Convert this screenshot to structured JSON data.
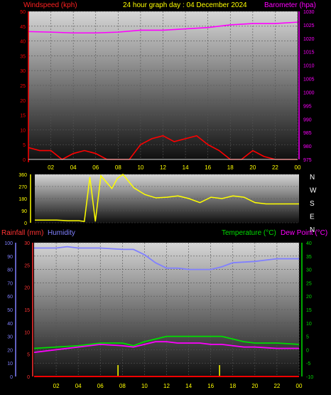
{
  "header": {
    "windspeed_label": "Windspeed (kph)",
    "graph_title": "24 hour graph day : 04 December 2024",
    "barometer_label": "Barometer (hpa)"
  },
  "colors": {
    "background": "#000000",
    "wind": "#ff0000",
    "gust_fill": "#ffffff",
    "avg_wind": "#00cc00",
    "barometer": "#ff00ff",
    "direction": "#ffff00",
    "rain_axis": "#ff3333",
    "humidity": "#8080ff",
    "temperature": "#00dd00",
    "dewpoint": "#ff00ff",
    "rain_mark": "#ffff00",
    "ticks": "#ffff00"
  },
  "chart_data": [
    {
      "type": "line",
      "title": "24 hour graph day : 04 December 2024",
      "x_ticks": [
        "02",
        "04",
        "06",
        "08",
        "10",
        "12",
        "14",
        "16",
        "18",
        "20",
        "22",
        "00"
      ],
      "x_range_hours": [
        0,
        24
      ],
      "left_axis": {
        "label": "Windspeed (kph)",
        "ticks": [
          0,
          5,
          10,
          15,
          20,
          25,
          30,
          35,
          40,
          45,
          50
        ],
        "range": [
          0,
          50
        ]
      },
      "right_axis": {
        "label": "Barometer (hpa)",
        "ticks": [
          975,
          980,
          985,
          990,
          995,
          1000,
          1005,
          1010,
          1015,
          1020,
          1025,
          1030
        ],
        "range": [
          975,
          1030
        ]
      },
      "grid": true,
      "series": [
        {
          "name": "Barometer (hpa)",
          "axis": "right",
          "x": [
            0,
            2,
            4,
            6,
            8,
            10,
            12,
            14,
            16,
            18,
            20,
            22,
            24
          ],
          "y": [
            1022.5,
            1022.3,
            1022,
            1022,
            1022.3,
            1023,
            1023,
            1023.5,
            1024,
            1025,
            1025.5,
            1025.5,
            1026
          ]
        },
        {
          "name": "Windspeed (kph)",
          "axis": "left",
          "x": [
            0,
            1,
            2,
            3,
            4,
            5,
            6,
            7,
            8,
            9,
            10,
            11,
            12,
            13,
            14,
            15,
            16,
            17,
            18,
            19,
            20,
            21,
            22,
            23,
            24
          ],
          "y": [
            4,
            3,
            3,
            0,
            2,
            3,
            2,
            0,
            0,
            0,
            5,
            7,
            8,
            6,
            7,
            8,
            5,
            3,
            0,
            0,
            3,
            1,
            0,
            0,
            0
          ]
        }
      ]
    },
    {
      "type": "line",
      "x_range_hours": [
        0,
        24
      ],
      "left_axis": {
        "ticks": [
          0,
          90,
          180,
          270,
          360
        ],
        "range": [
          0,
          360
        ]
      },
      "right_axis": {
        "ticks": [
          "N",
          "W",
          "S",
          "E",
          "N"
        ]
      },
      "grid": true,
      "series": [
        {
          "name": "wind direction",
          "x": [
            0,
            1,
            2,
            3,
            4,
            4.5,
            5,
            5.5,
            6,
            7,
            7.5,
            8,
            9,
            10,
            11,
            12,
            13,
            14,
            15,
            16,
            17,
            18,
            19,
            20,
            21,
            22,
            23,
            24
          ],
          "y": [
            20,
            20,
            20,
            15,
            15,
            10,
            340,
            10,
            350,
            255,
            330,
            360,
            260,
            210,
            185,
            190,
            200,
            180,
            150,
            190,
            180,
            200,
            190,
            150,
            140,
            140,
            140,
            140
          ]
        }
      ]
    },
    {
      "type": "line",
      "x_ticks": [
        "02",
        "04",
        "06",
        "08",
        "10",
        "12",
        "14",
        "16",
        "18",
        "20",
        "22",
        "00"
      ],
      "x_range_hours": [
        0,
        24
      ],
      "rain_axis": {
        "label": "Rainfall (mm)",
        "ticks": [
          0,
          5,
          10,
          15,
          20,
          25,
          30
        ],
        "range": [
          0,
          30
        ]
      },
      "humidity_axis": {
        "label": "Humidity",
        "ticks": [
          0,
          10,
          20,
          30,
          40,
          50,
          60,
          70,
          80,
          90,
          100
        ],
        "range": [
          0,
          100
        ]
      },
      "temp_axis": {
        "label": "Temperature (°C)",
        "ticks": [
          -10,
          -5,
          0,
          5,
          10,
          15,
          20,
          25,
          30,
          35,
          40
        ],
        "range": [
          -10,
          40
        ]
      },
      "dewpoint_label": "Dew Point (°C)",
      "grid": true,
      "series": [
        {
          "name": "Humidity",
          "axis": "humidity",
          "x": [
            0,
            2,
            3,
            4,
            6,
            8,
            9,
            10,
            11,
            12,
            13,
            14,
            15,
            16,
            17,
            18,
            20,
            22,
            24
          ],
          "y": [
            96,
            96,
            97,
            96,
            96,
            95,
            95,
            91,
            85,
            81,
            81,
            80,
            80,
            80,
            82,
            85,
            86,
            88,
            88
          ]
        },
        {
          "name": "Temperature (°C)",
          "axis": "temp",
          "x": [
            0,
            2,
            4,
            6,
            8,
            9,
            10,
            11,
            12,
            13,
            14,
            15,
            16,
            17,
            18,
            19,
            20,
            22,
            24
          ],
          "y": [
            0.5,
            1,
            1.5,
            2.5,
            2.5,
            1.5,
            3,
            4,
            5,
            5,
            5,
            5,
            5,
            5,
            4,
            3,
            2.5,
            2.5,
            2
          ]
        },
        {
          "name": "Dew Point (°C)",
          "axis": "temp",
          "x": [
            0,
            2,
            4,
            6,
            8,
            9,
            10,
            11,
            12,
            13,
            14,
            15,
            16,
            17,
            18,
            19,
            20,
            22,
            24
          ],
          "y": [
            -1,
            0,
            1,
            2,
            1.5,
            1,
            2,
            3,
            3,
            2.5,
            2.5,
            2.5,
            2,
            2,
            1.5,
            1,
            1,
            0.5,
            0.5
          ]
        },
        {
          "name": "Rainfall (mm)",
          "axis": "rain",
          "x": [
            0,
            7.6,
            8,
            16.8,
            24
          ],
          "y": [
            0,
            0.3,
            0,
            0.3,
            0
          ]
        }
      ]
    }
  ]
}
